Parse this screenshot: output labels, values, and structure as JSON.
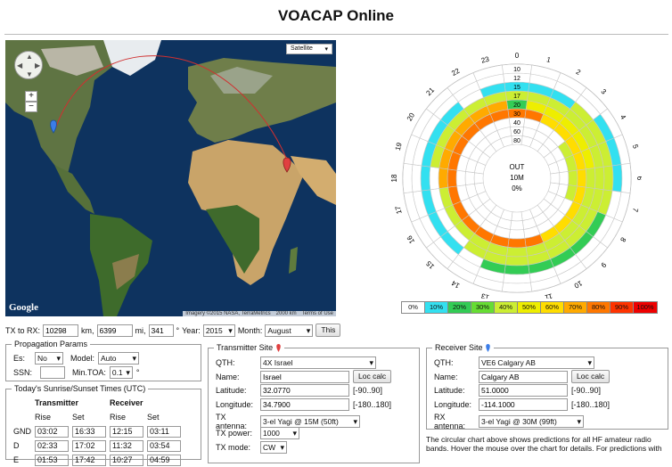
{
  "title": "VOACAP Online",
  "map": {
    "type_label": "Satellite",
    "google": "Google",
    "imagery": "Imagery ©2015 NASA, TerraMetrics",
    "scale": "2000 km",
    "terms": "Terms of Use",
    "zoom_in": "+",
    "zoom_out": "−"
  },
  "polar": {
    "hours": [
      "0",
      "1",
      "2",
      "3",
      "4",
      "5",
      "6",
      "7",
      "8",
      "9",
      "10",
      "11",
      "12",
      "13",
      "14",
      "15",
      "16",
      "17",
      "18",
      "19",
      "20",
      "21",
      "22",
      "23"
    ],
    "bands": [
      "10",
      "12",
      "15",
      "17",
      "20",
      "30",
      "40",
      "60",
      "80"
    ],
    "center": [
      "OUT",
      "10M",
      "0%"
    ],
    "legend": [
      "0%",
      "10%",
      "20%",
      "30%",
      "40%",
      "50%",
      "60%",
      "70%",
      "80%",
      "90%",
      "100%"
    ],
    "legend_colors": [
      "#ffffff",
      "#33e0f0",
      "#33cc55",
      "#66dd33",
      "#ccee33",
      "#eeee00",
      "#ffdd00",
      "#ffaa00",
      "#ff7700",
      "#ff3300",
      "#ee0000"
    ]
  },
  "txrow": {
    "label": "TX to RX:",
    "km": "10298",
    "km_unit": "km,",
    "mi": "6399",
    "mi_unit": "mi,",
    "deg": "341",
    "deg_unit": "°",
    "year_label": "Year:",
    "year": "2015",
    "month_label": "Month:",
    "month": "August",
    "this_btn": "This"
  },
  "prop": {
    "legend": "Propagation Params",
    "es_label": "Es:",
    "es": "No",
    "model_label": "Model:",
    "model": "Auto",
    "ssn_label": "SSN:",
    "ssn": "",
    "mintoa_label": "Min.TOA:",
    "mintoa": "0.1",
    "deg": "°"
  },
  "sun": {
    "legend": "Today's Sunrise/Sunset Times (UTC)",
    "transmitter": "Transmitter",
    "receiver": "Receiver",
    "rise": "Rise",
    "set": "Set",
    "rows": [
      {
        "label": "GND",
        "tr": "03:02",
        "ts": "16:33",
        "rr": "12:15",
        "rs": "03:11"
      },
      {
        "label": "D",
        "tr": "02:33",
        "ts": "17:02",
        "rr": "11:32",
        "rs": "03:54"
      },
      {
        "label": "E",
        "tr": "01:53",
        "ts": "17:42",
        "rr": "10:27",
        "rs": "04:59"
      }
    ]
  },
  "tx": {
    "legend": "Transmitter Site",
    "qth_label": "QTH:",
    "qth": "4X Israel",
    "name_label": "Name:",
    "name": "Israel",
    "loc_btn": "Loc calc",
    "lat_label": "Latitude:",
    "lat": "32.0770",
    "lat_range": "[-90..90]",
    "lon_label": "Longitude:",
    "lon": "34.7900",
    "lon_range": "[-180..180]",
    "ant_label": "TX antenna:",
    "ant": "3-el Yagi @ 15M (50ft)",
    "power_label": "TX power:",
    "power": "1000 W",
    "mode_label": "TX mode:",
    "mode": "CW"
  },
  "rx": {
    "legend": "Receiver Site",
    "qth_label": "QTH:",
    "qth": "VE6 Calgary AB",
    "name_label": "Name:",
    "name": "Calgary AB",
    "loc_btn": "Loc calc",
    "lat_label": "Latitude:",
    "lat": "51.0000",
    "lat_range": "[-90..90]",
    "lon_label": "Longitude:",
    "lon": "-114.1000",
    "lon_range": "[-180..180]",
    "ant_label": "RX antenna:",
    "ant": "3-el Yagi @ 30M (99ft)"
  },
  "description": "The circular chart above shows predictions for all HF amateur radio bands. Hover the mouse over the chart for details. For predictions with"
}
